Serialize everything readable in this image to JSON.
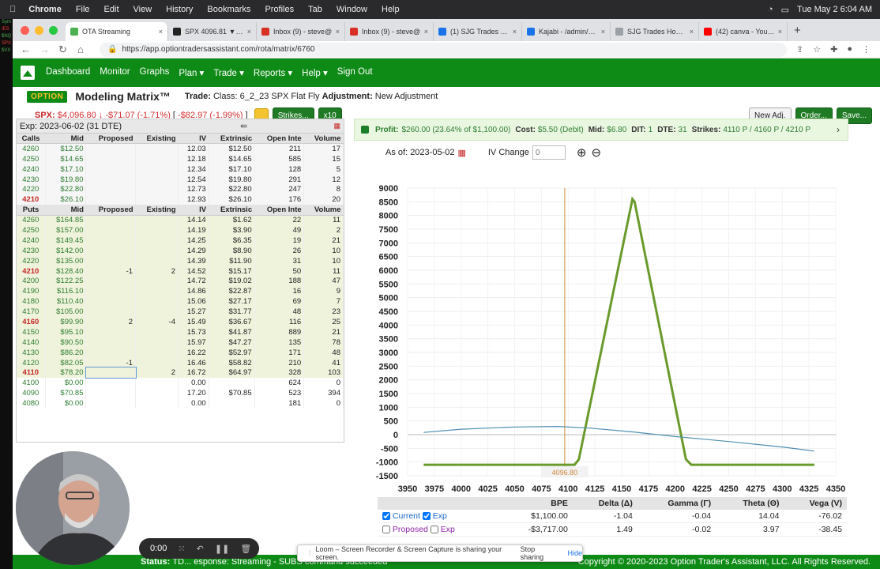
{
  "mac": {
    "app": "Chrome",
    "menus": [
      "File",
      "Edit",
      "View",
      "History",
      "Bookmarks",
      "Profiles",
      "Tab",
      "Window",
      "Help"
    ],
    "clock": "Tue May 2  6:04 AM"
  },
  "browser": {
    "tabs": [
      {
        "label": "OTA Streaming",
        "color": "#4caf50",
        "active": true
      },
      {
        "label": "SPX 4096.81 ▼ −1.7",
        "color": "#222222",
        "active": false
      },
      {
        "label": "Inbox (9) - steve@",
        "color": "#d93025",
        "active": false
      },
      {
        "label": "Inbox (9) - steve@",
        "color": "#d93025",
        "active": false
      },
      {
        "label": "(1) SJG Trades Tra",
        "color": "#1a73e8",
        "active": false
      },
      {
        "label": "Kajabi - /admin/pro",
        "color": "#1a73e8",
        "active": false
      },
      {
        "label": "SJG Trades Home P",
        "color": "#9aa0a6",
        "active": false
      },
      {
        "label": "(42) canva - YouTu",
        "color": "#ff0000",
        "active": false
      }
    ],
    "url": "https://app.optiontradersassistant.com/rota/matrix/6760"
  },
  "nav": {
    "items": [
      "Dashboard",
      "Monitor",
      "Graphs",
      "Plan ▾",
      "Trade ▾",
      "Reports ▾",
      "Help ▾",
      "Sign Out"
    ]
  },
  "header": {
    "brand_top": "OPTION",
    "brand_sub": "TRADER'S ASSISTANT",
    "title": "Modeling Matrix™",
    "trade_label": "Trade:",
    "trade_value": "Class: 6_2_23 SPX Flat Fly",
    "adj_label": "Adjustment:",
    "adj_value": "New Adjustment"
  },
  "quote": {
    "symbol": "SPX:",
    "price": "$4,096.80",
    "change": "-$71.07 (-1.71%)",
    "change2": "-$82.97 (-1.99%)",
    "strikes_btn": "Strikes...",
    "x10_btn": "x10",
    "new_adj_btn": "New Adj.",
    "order_btn": "Order...",
    "save_btn": "Save..."
  },
  "matrix": {
    "expiration": "Exp: 2023-06-02 (31 DTE)",
    "columns": [
      "Calls",
      "Mid",
      "Proposed",
      "Existing",
      "IV",
      "Extrinsic",
      "Open Inte",
      "Volume"
    ],
    "put_columns": [
      "Puts",
      "Mid",
      "Proposed",
      "Existing",
      "IV",
      "Extrinsic",
      "Open Inte",
      "Volume"
    ],
    "calls": [
      [
        "4260",
        "$12.50",
        "",
        "",
        "12.03",
        "$12.50",
        "211",
        "17"
      ],
      [
        "4250",
        "$14.65",
        "",
        "",
        "12.18",
        "$14.65",
        "585",
        "15"
      ],
      [
        "4240",
        "$17.10",
        "",
        "",
        "12.34",
        "$17.10",
        "128",
        "5"
      ],
      [
        "4230",
        "$19.80",
        "",
        "",
        "12.54",
        "$19.80",
        "291",
        "12"
      ],
      [
        "4220",
        "$22.80",
        "",
        "",
        "12.73",
        "$22.80",
        "247",
        "8"
      ],
      [
        "4210",
        "$26.10",
        "",
        "",
        "12.93",
        "$26.10",
        "176",
        "20"
      ]
    ],
    "puts": [
      [
        "4260",
        "$164.85",
        "",
        "",
        "14.14",
        "$1.62",
        "22",
        "11"
      ],
      [
        "4250",
        "$157.00",
        "",
        "",
        "14.19",
        "$3.90",
        "49",
        "2"
      ],
      [
        "4240",
        "$149.45",
        "",
        "",
        "14.25",
        "$6.35",
        "19",
        "21"
      ],
      [
        "4230",
        "$142.00",
        "",
        "",
        "14.29",
        "$8.90",
        "26",
        "10"
      ],
      [
        "4220",
        "$135.00",
        "",
        "",
        "14.39",
        "$11.90",
        "31",
        "10"
      ],
      [
        "4210",
        "$128.40",
        "-1",
        "2",
        "14.52",
        "$15.17",
        "50",
        "11"
      ],
      [
        "4200",
        "$122.25",
        "",
        "",
        "14.72",
        "$19.02",
        "188",
        "47"
      ],
      [
        "4190",
        "$116.10",
        "",
        "",
        "14.86",
        "$22.87",
        "16",
        "9"
      ],
      [
        "4180",
        "$110.40",
        "",
        "",
        "15.06",
        "$27.17",
        "69",
        "7"
      ],
      [
        "4170",
        "$105.00",
        "",
        "",
        "15.27",
        "$31.77",
        "48",
        "23"
      ],
      [
        "4160",
        "$99.90",
        "2",
        "-4",
        "15.49",
        "$36.67",
        "116",
        "25"
      ],
      [
        "4150",
        "$95.10",
        "",
        "",
        "15.73",
        "$41.87",
        "889",
        "21"
      ],
      [
        "4140",
        "$90.50",
        "",
        "",
        "15.97",
        "$47.27",
        "135",
        "78"
      ],
      [
        "4130",
        "$86.20",
        "",
        "",
        "16.22",
        "$52.97",
        "171",
        "48"
      ],
      [
        "4120",
        "$82.05",
        "-1",
        "",
        "16.46",
        "$58.82",
        "210",
        "41"
      ],
      [
        "4110",
        "$78.20",
        "",
        "2",
        "16.72",
        "$64.97",
        "328",
        "103"
      ],
      [
        "4100",
        "$0.00",
        "",
        "",
        "0.00",
        "",
        "624",
        "0"
      ],
      [
        "4090",
        "$70.85",
        "",
        "",
        "17.20",
        "$70.85",
        "523",
        "394"
      ],
      [
        "4080",
        "$0.00",
        "",
        "",
        "0.00",
        "",
        "181",
        "0"
      ]
    ],
    "highlight_strikes": [
      "4210",
      "4160",
      "4110"
    ]
  },
  "profit": {
    "label": "Profit:",
    "value": "$260.00 (23.64% of $1,100.00)",
    "cost_label": "Cost:",
    "cost": "$5.50 (Debit)",
    "mid_label": "Mid:",
    "mid": "$6.80",
    "dit_label": "DIT:",
    "dit": "1",
    "dte_label": "DTE:",
    "dte": "31",
    "strikes_label": "Strikes:",
    "strikes": "4110 P / 4160 P / 4210 P"
  },
  "asof": {
    "label": "As of:",
    "date": "2023-05-02",
    "iv_label": "IV Change",
    "iv_value": "0"
  },
  "chart_data": {
    "type": "line",
    "xlim": [
      3950,
      4350
    ],
    "ylim": [
      -1500,
      9000
    ],
    "xticks": [
      3950,
      3975,
      4000,
      4025,
      4050,
      4075,
      4100,
      4125,
      4150,
      4175,
      4200,
      4225,
      4250,
      4275,
      4300,
      4325,
      4350
    ],
    "yticks": [
      9000,
      8500,
      8000,
      7500,
      7000,
      6500,
      6000,
      5500,
      5000,
      4500,
      4000,
      3500,
      3000,
      2500,
      2000,
      1500,
      1000,
      500,
      0,
      -500,
      -1000,
      -1500
    ],
    "price_marker": 4096.8,
    "price_marker_label": "4096.80",
    "series": [
      {
        "color": "#6a9a2c",
        "x": [
          3965,
          4095,
          4106,
          4110,
          4160,
          4162,
          4210,
          4215,
          4330
        ],
        "y": [
          -1100,
          -1100,
          -1100,
          -900,
          8600,
          8500,
          -900,
          -1100,
          -1100
        ]
      },
      {
        "color": "#4f8fb0",
        "x": [
          3965,
          4000,
          4050,
          4090,
          4120,
          4160,
          4200,
          4250,
          4300,
          4330
        ],
        "y": [
          80,
          200,
          280,
          300,
          240,
          100,
          -70,
          -250,
          -450,
          -600
        ]
      }
    ]
  },
  "greeks": {
    "headers": [
      "BPE",
      "Delta (Δ)",
      "Gamma (Γ)",
      "Theta (Θ)",
      "Vega (V)"
    ],
    "current": {
      "label": "Current",
      "exp": "Exp",
      "values": [
        "$1,100.00",
        "-1.04",
        "-0.04",
        "14.04",
        "-76.02"
      ]
    },
    "proposed": {
      "label": "Proposed",
      "exp": "Exp",
      "values": [
        "-$3,717.00",
        "1.49",
        "-0.02",
        "3.97",
        "-38.45"
      ]
    }
  },
  "status": {
    "label": "Status:",
    "text": "TD... esponse: Streaming - SUBS command succeeded",
    "copyright": "Copyright © 2020-2023 Option Trader's Assistant, LLC. All Rights Reserved."
  },
  "loom": {
    "text": "Loom – Screen Recorder & Screen Capture is sharing your screen.",
    "stop": "Stop sharing",
    "hide": "Hide"
  },
  "recorder": {
    "time": "0:00"
  }
}
